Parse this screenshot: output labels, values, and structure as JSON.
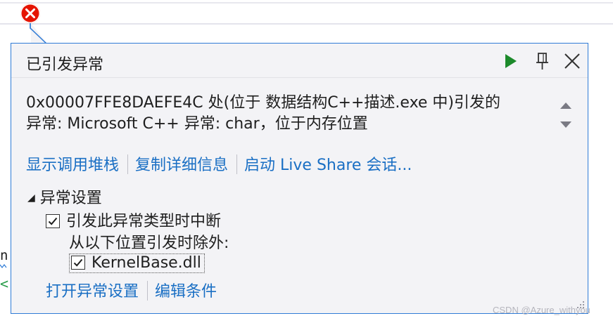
{
  "popup": {
    "title": "已引发异常",
    "message_line1": "0x00007FFE8DAEFE4C 处(位于 数据结构C++描述.exe 中)引发的",
    "message_line2": "异常: Microsoft C++ 异常: char，位于内存位置",
    "links": {
      "show_call_stack": "显示调用堆栈",
      "copy_details": "复制详细信息",
      "start_live_share": "启动 Live Share 会话..."
    },
    "exception_settings": {
      "header": "异常设置",
      "break_when_thrown_label": "引发此异常类型时中断",
      "break_when_thrown_checked": true,
      "except_when_thrown_from_label": "从以下位置引发时除外:",
      "module_label": "KernelBase.dll",
      "module_checked": true
    },
    "bottom_links": {
      "open_exception_settings": "打开异常设置",
      "edit_conditions": "编辑条件"
    },
    "buttons": {
      "continue_icon": "play-icon",
      "pin_icon": "pin-icon",
      "close_icon": "close-icon"
    }
  },
  "editor": {
    "fragment_1": "n",
    "fragment_2": "<"
  },
  "watermark": "CSDN @Azure_withyou",
  "colors": {
    "accent_border": "#2f7bd6",
    "link": "#1a6fc4",
    "error_red": "#e51400",
    "play_green": "#1c8a2b"
  }
}
